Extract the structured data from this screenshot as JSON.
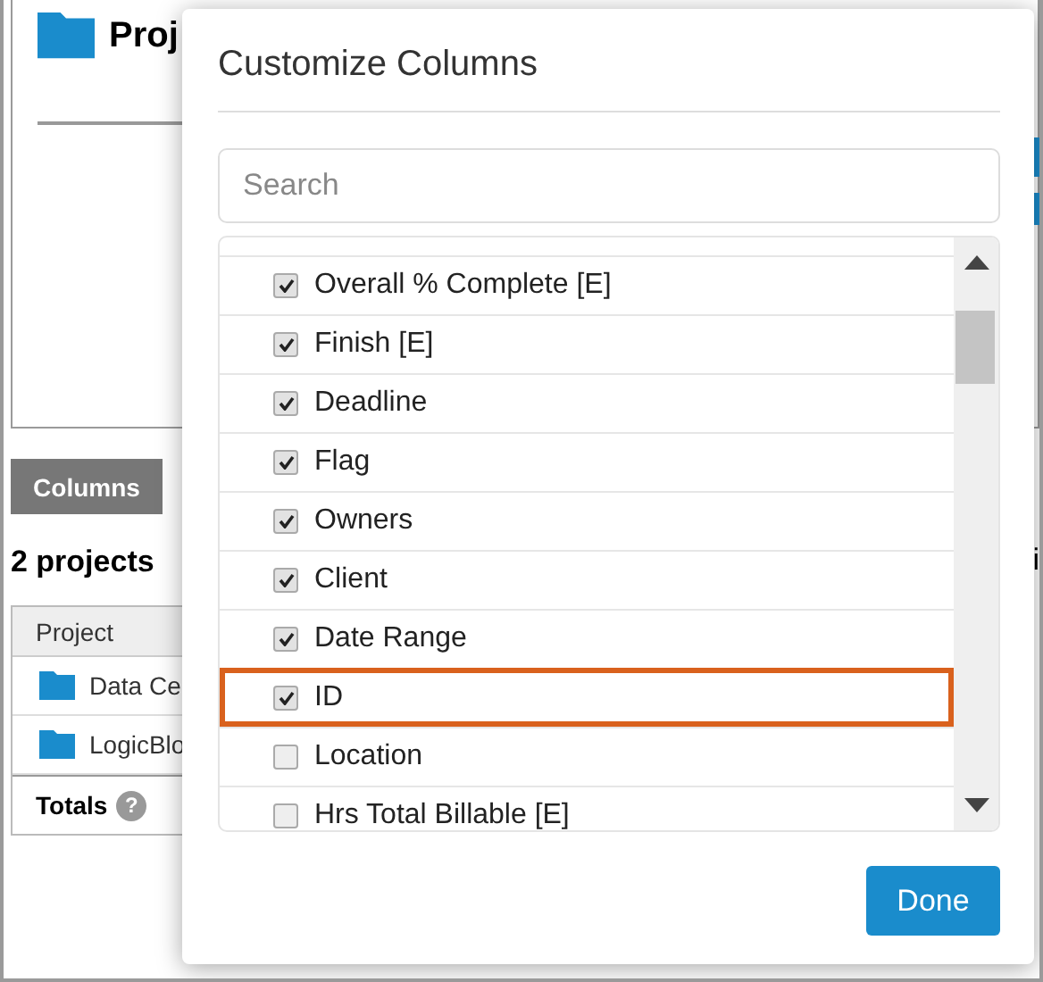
{
  "page": {
    "title": "Proj",
    "columns_tab": "Columns",
    "summary": "2 projects",
    "summary_right": "i",
    "table": {
      "columns": [
        "Project"
      ],
      "rows": [
        {
          "name": "Data Ce"
        },
        {
          "name": "LogicBlo"
        }
      ],
      "totals": "Totals",
      "totals_help": "?"
    }
  },
  "dialog": {
    "title": "Customize Columns",
    "search": {
      "placeholder": "Search"
    },
    "items": [
      {
        "label": "Overall % Complete [E]",
        "checked": true,
        "highlighted": false
      },
      {
        "label": "Finish [E]",
        "checked": true,
        "highlighted": false
      },
      {
        "label": "Deadline",
        "checked": true,
        "highlighted": false
      },
      {
        "label": "Flag",
        "checked": true,
        "highlighted": false
      },
      {
        "label": "Owners",
        "checked": true,
        "highlighted": false
      },
      {
        "label": "Client",
        "checked": true,
        "highlighted": false
      },
      {
        "label": "Date Range",
        "checked": true,
        "highlighted": false
      },
      {
        "label": "ID",
        "checked": true,
        "highlighted": true
      },
      {
        "label": "Location",
        "checked": false,
        "highlighted": false
      },
      {
        "label": "Hrs Total Billable [E]",
        "checked": false,
        "highlighted": false
      }
    ],
    "done": "Done"
  }
}
